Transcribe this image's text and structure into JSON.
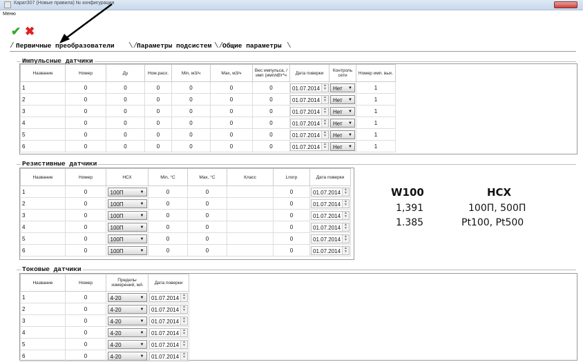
{
  "window": {
    "title": "Карат307 (Новые правила) № конфигурация"
  },
  "menu": {
    "label": "Меню"
  },
  "toolbar": {
    "ok_icon": "checkmark-icon",
    "cancel_icon": "cross-icon",
    "ok_color": "#35a829",
    "cancel_color": "#dd2222"
  },
  "tabs": [
    "Первичные преобразователи",
    "Параметры подсистем",
    "Общие параметры"
  ],
  "pulse": {
    "title": "Импульсные датчики",
    "headers": [
      "Название",
      "Номер",
      "Ду",
      "Ном.расх.",
      "Min, м3/ч",
      "Max, м3/ч",
      "Вес импульса, /имп (имп/кВт*ч",
      "Дата поверки",
      "Контроль сети",
      "Номер имп. вых."
    ],
    "rows": [
      [
        "1",
        "0",
        "0",
        "0",
        "0",
        "0",
        "0",
        "01.07.2014",
        "Нет",
        "1"
      ],
      [
        "2",
        "0",
        "0",
        "0",
        "0",
        "0",
        "0",
        "01.07.2014",
        "Нет",
        "1"
      ],
      [
        "3",
        "0",
        "0",
        "0",
        "0",
        "0",
        "0",
        "01.07.2014",
        "Нет",
        "1"
      ],
      [
        "4",
        "0",
        "0",
        "0",
        "0",
        "0",
        "0",
        "01.07.2014",
        "Нет",
        "1"
      ],
      [
        "5",
        "0",
        "0",
        "0",
        "0",
        "0",
        "0",
        "01.07.2014",
        "Нет",
        "1"
      ],
      [
        "6",
        "0",
        "0",
        "0",
        "0",
        "0",
        "0",
        "01.07.2014",
        "Нет",
        "1"
      ]
    ]
  },
  "resist": {
    "title": "Резистивные датчики",
    "headers": [
      "Название",
      "Номер",
      "НСХ",
      "Min, °С",
      "Max, °С",
      "Класс",
      "Lпогр",
      "Дата поверки"
    ],
    "rows": [
      [
        "1",
        "0",
        "100П",
        "0",
        "0",
        "",
        "0",
        "01.07.2014"
      ],
      [
        "2",
        "0",
        "100П",
        "0",
        "0",
        "",
        "0",
        "01.07.2014"
      ],
      [
        "3",
        "0",
        "100П",
        "0",
        "0",
        "",
        "0",
        "01.07.2014"
      ],
      [
        "4",
        "0",
        "100П",
        "0",
        "0",
        "",
        "0",
        "01.07.2014"
      ],
      [
        "5",
        "0",
        "100П",
        "0",
        "0",
        "",
        "0",
        "01.07.2014"
      ],
      [
        "6",
        "0",
        "100П",
        "0",
        "0",
        "",
        "0",
        "01.07.2014"
      ]
    ]
  },
  "current": {
    "title": "Токовые датчики",
    "headers": [
      "Название",
      "Номер",
      "Пределы измерений, мА",
      "Дата поверки"
    ],
    "rows": [
      [
        "1",
        "0",
        "4-20",
        "01.07.2014"
      ],
      [
        "2",
        "0",
        "4-20",
        "01.07.2014"
      ],
      [
        "3",
        "0",
        "4-20",
        "01.07.2014"
      ],
      [
        "4",
        "0",
        "4-20",
        "01.07.2014"
      ],
      [
        "5",
        "0",
        "4-20",
        "01.07.2014"
      ],
      [
        "6",
        "0",
        "4-20",
        "01.07.2014"
      ]
    ]
  },
  "legend": {
    "col1_header": "W100",
    "col2_header": "НСХ",
    "rows": [
      [
        "1,391",
        "100П, 500П"
      ],
      [
        "1.385",
        "Pt100, Pt500"
      ]
    ]
  }
}
